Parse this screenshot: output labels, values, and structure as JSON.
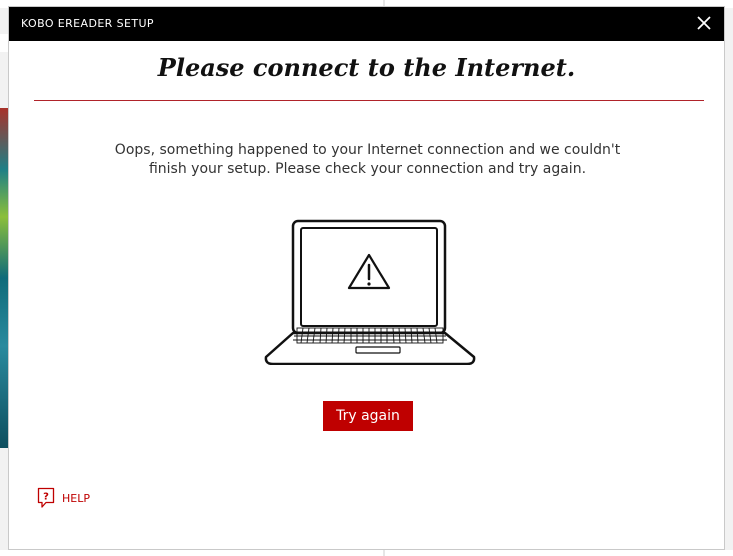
{
  "window": {
    "title": "KOBO EREADER SETUP",
    "close_icon": "close-icon"
  },
  "main": {
    "heading": "Please connect to the Internet.",
    "message_line1": "Oops, something happened to your Internet connection and we couldn't",
    "message_line2": "finish your setup. Please check your connection and try again.",
    "illustration_icon": "laptop-warning-icon",
    "try_again_label": "Try again"
  },
  "footer": {
    "help_icon": "help-icon",
    "help_label": "HELP"
  },
  "colors": {
    "accent": "#bf0000",
    "titlebar": "#000000",
    "rule": "#b0232a"
  }
}
